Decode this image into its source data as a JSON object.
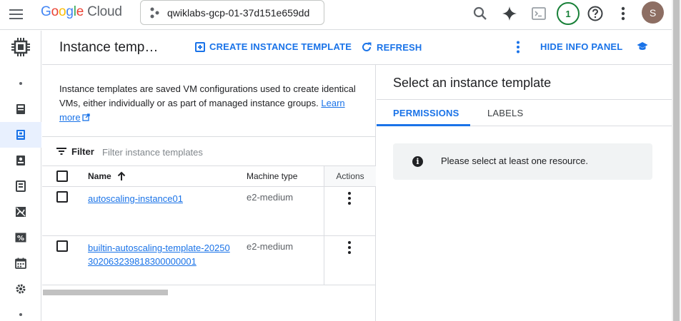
{
  "topbar": {
    "logo": {
      "g": "G",
      "o1": "o",
      "o2": "o",
      "g2": "g",
      "l": "l",
      "e": "e",
      "cloud": "Cloud"
    },
    "project_name": "qwiklabs-gcp-01-37d151e659dd",
    "notification_count": "1",
    "avatar_initial": "S",
    "icons": [
      "menu-icon",
      "search-icon",
      "gemini-icon",
      "cloud-shell-icon",
      "help-icon",
      "more-vert-icon"
    ]
  },
  "rail": {
    "items": [
      "compute-engine-icon",
      "dot",
      "vm-instances-icon",
      "instance-templates-icon",
      "sole-tenant-icon",
      "machine-images-icon",
      "tpu-icon",
      "committed-use-icon",
      "reservations-icon",
      "settings-icon",
      "dot"
    ]
  },
  "header": {
    "title": "Instance temp…",
    "create_label": "CREATE INSTANCE TEMPLATE",
    "refresh_label": "REFRESH",
    "hide_info_label": "HIDE INFO PANEL"
  },
  "description": {
    "text": "Instance templates are saved VM configurations used to create identical VMs, either individually or as part of managed instance groups.",
    "learn_more": "Learn more"
  },
  "filter": {
    "label": "Filter",
    "placeholder": "Filter instance templates"
  },
  "table": {
    "columns": {
      "name": "Name",
      "machine_type": "Machine type",
      "actions": "Actions"
    },
    "rows": [
      {
        "name": "autoscaling-instance01",
        "machine_type": "e2-medium"
      },
      {
        "name": "builtin-autoscaling-template-20250302063239818300000001",
        "machine_type": "e2-medium"
      }
    ]
  },
  "info_panel": {
    "title": "Select an instance template",
    "tabs": [
      "PERMISSIONS",
      "LABELS"
    ],
    "active_tab": "PERMISSIONS",
    "message": "Please select at least one resource."
  },
  "colors": {
    "accent": "#1a73e8",
    "text": "#202124",
    "border": "#dadce0",
    "notif": "#188038",
    "avatar": "#8d6e63"
  }
}
